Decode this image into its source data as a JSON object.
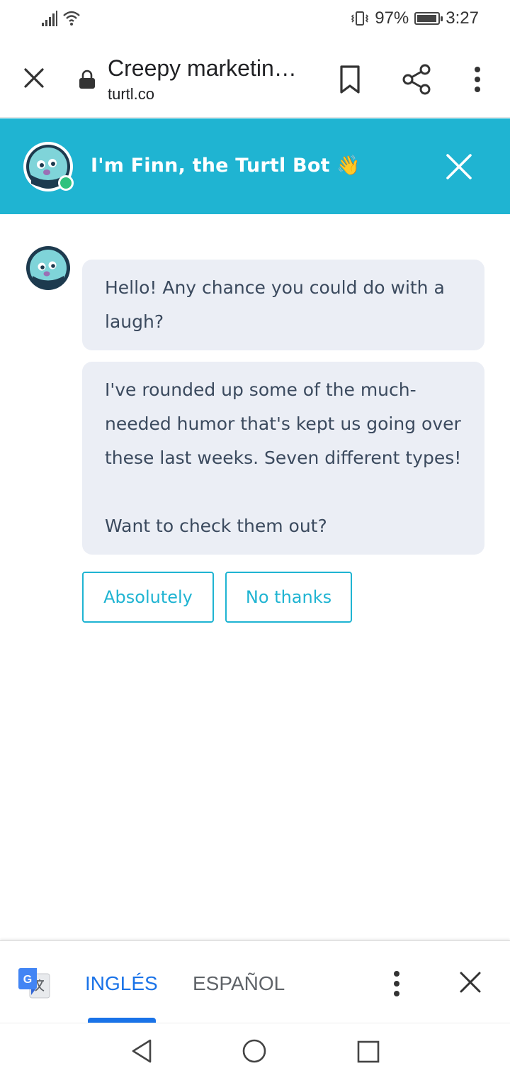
{
  "status_bar": {
    "battery_percent": "97%",
    "battery_level": 0.97,
    "time": "3:27",
    "icons": [
      "signal-icon",
      "wifi-icon",
      "vibrate-icon",
      "battery-icon"
    ]
  },
  "browser": {
    "page_title": "Creepy marketin…",
    "url": "turtl.co",
    "icons": [
      "close-icon",
      "lock-icon",
      "bookmark-icon",
      "share-icon",
      "more-vert-icon"
    ]
  },
  "chat": {
    "header_title": "I'm Finn, the Turtl Bot 👋",
    "accent_color": "#1fb4d2",
    "online_color": "#2fc27e",
    "messages": [
      {
        "lines": [
          "Hello! Any chance you could do with a",
          "laugh?"
        ]
      },
      {
        "lines": [
          "I've rounded up some of the much-",
          "needed humor that's kept us going over",
          "these last weeks. Seven different types!"
        ],
        "lines2": [
          "Want to check them out?"
        ]
      }
    ],
    "replies": [
      "Absolutely",
      "No thanks"
    ]
  },
  "translate_bar": {
    "lang_selected": "INGLÉS",
    "lang_other": "ESPAÑOL",
    "selected_color": "#1a73e8"
  }
}
